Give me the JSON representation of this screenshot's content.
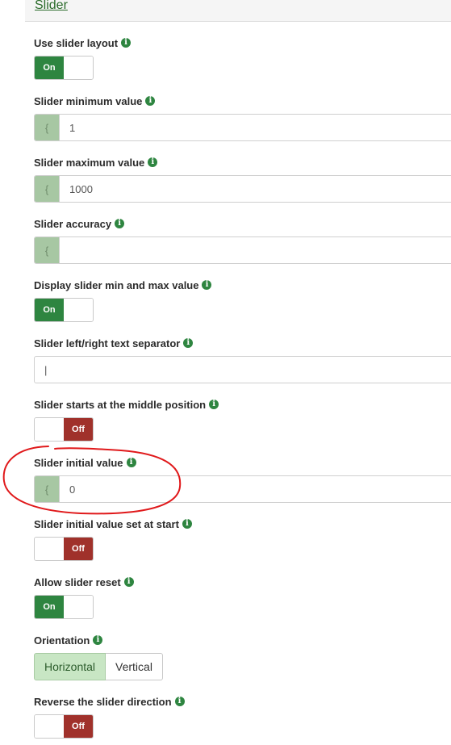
{
  "header": {
    "title": "Slider"
  },
  "fields": {
    "use_slider_layout": {
      "label": "Use slider layout",
      "state": "On"
    },
    "slider_min": {
      "label": "Slider minimum value",
      "addon": "{",
      "value": "1"
    },
    "slider_max": {
      "label": "Slider maximum value",
      "addon": "{",
      "value": "1000"
    },
    "slider_accuracy": {
      "label": "Slider accuracy",
      "addon": "{",
      "value": ""
    },
    "display_min_max": {
      "label": "Display slider min and max value",
      "state": "On"
    },
    "text_separator": {
      "label": "Slider left/right text separator",
      "value": "|"
    },
    "starts_middle": {
      "label": "Slider starts at the middle position",
      "state": "Off"
    },
    "initial_value": {
      "label": "Slider initial value",
      "addon": "{",
      "value": "0"
    },
    "initial_at_start": {
      "label": "Slider initial value set at start",
      "state": "Off"
    },
    "allow_reset": {
      "label": "Allow slider reset",
      "state": "On"
    },
    "orientation": {
      "label": "Orientation",
      "options": [
        "Horizontal",
        "Vertical"
      ],
      "selected": "Horizontal"
    },
    "reverse_direction": {
      "label": "Reverse the slider direction",
      "state": "Off"
    }
  },
  "colors": {
    "on": "#2e8540",
    "off": "#a0312b",
    "accent": "#2e8540",
    "annotation": "#e0191b"
  },
  "icons": {
    "info": "info-circle-icon"
  }
}
